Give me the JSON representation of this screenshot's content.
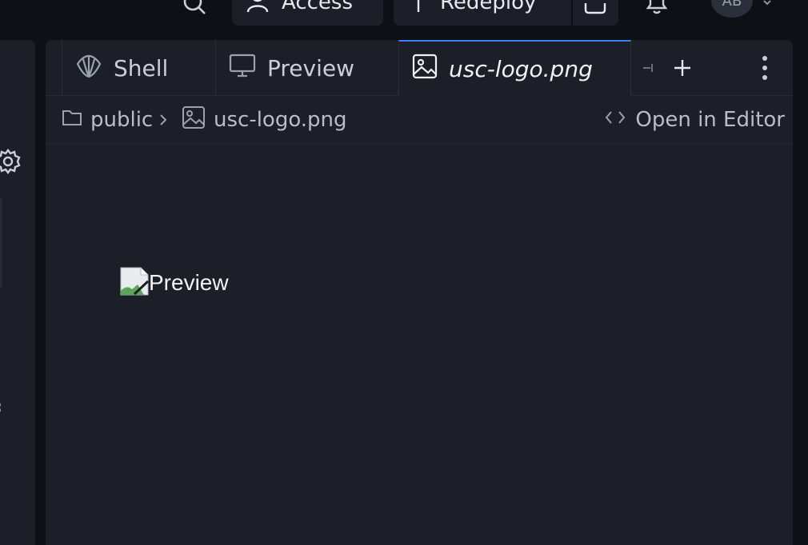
{
  "topbar": {
    "access_label": "Access",
    "redeploy_label": "Redeploy",
    "avatar_initials": "AB"
  },
  "tabs": {
    "shell_label": "Shell",
    "preview_label": "Preview",
    "active_label": "usc-logo.png"
  },
  "breadcrumb": {
    "folder": "public",
    "file": "usc-logo.png",
    "open_in_editor": "Open in Editor"
  },
  "preview": {
    "image_alt": "Preview"
  },
  "colors": {
    "accent": "#3b82f6",
    "panel_bg": "#1c1f27",
    "app_bg": "#0e1016"
  }
}
